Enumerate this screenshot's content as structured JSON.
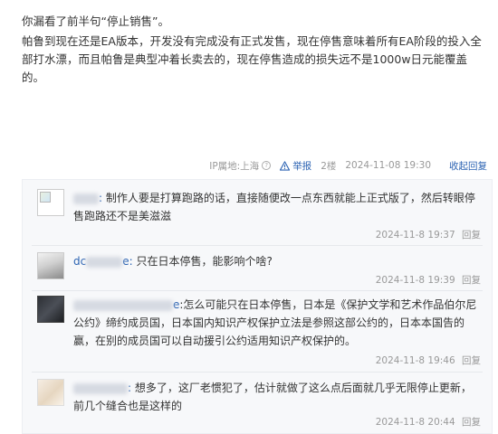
{
  "post": {
    "line1": "你漏看了前半句“停止销售”。",
    "line2": "帕鲁到现在还是EA版本，开发没有完成没有正式发售，现在停售意味着所有EA阶段的投入全部打水漂，而且帕鲁是典型冲着长卖去的，现在停售造成的损失远不是1000w日元能覆盖的。"
  },
  "tail": {
    "ip": "IP属地:上海",
    "help_glyph": "?",
    "report": "举报",
    "floor": "2楼",
    "time": "2024-11-08 19:30",
    "collapse": "收起回复"
  },
  "replies": [
    {
      "user_visible": "",
      "text": "制作人要是打算跑路的话，直接随便改一点东西就能上正式版了，然后转眼停售跑路还不是美滋滋",
      "time": "2024-11-8 19:37",
      "action": "回复"
    },
    {
      "user_visible": "dc",
      "user_suffix": "e:",
      "text": "只在日本停售，能影响个啥?",
      "time": "2024-11-8 19:39",
      "action": "回复"
    },
    {
      "user_visible": "",
      "user_suffix": "e",
      "text": ":怎么可能只在日本停售，日本是《保护文学和艺术作品伯尔尼公约》缔约成员国，日本国内知识产权保护立法是参照这部公约的，日本本国告的赢，在别的成员国可以自动援引公约适用知识产权保护的。",
      "time": "2024-11-8 19:46",
      "action": "回复"
    },
    {
      "user_visible": "",
      "text": "想多了，这厂老惯犯了，估计就做了这么点后面就几乎无限停止更新，前几个缝合也是这样的",
      "time": "2024-11-8 20:44",
      "action": "回复"
    }
  ],
  "colors": {
    "link": "#2d64b3",
    "muted": "#999999",
    "reply_bg": "#f7f8fa"
  }
}
